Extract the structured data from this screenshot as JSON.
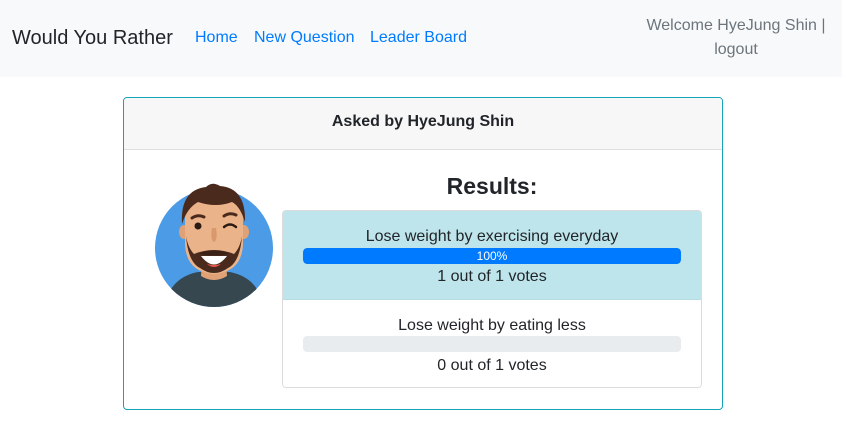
{
  "navbar": {
    "brand": "Would You Rather",
    "links": [
      "Home",
      "New Question",
      "Leader Board"
    ],
    "welcome": "Welcome HyeJung Shin |",
    "logout": "logout"
  },
  "poll": {
    "asked_by": "Asked by HyeJung Shin",
    "results_title": "Results:",
    "options": [
      {
        "text": "Lose weight by exercising everyday",
        "percent": 100,
        "percent_label": "100%",
        "votes": "1 out of 1 votes",
        "highlighted": true
      },
      {
        "text": "Lose weight by eating less",
        "percent": 0,
        "percent_label": "",
        "votes": "0 out of 1 votes",
        "highlighted": false
      }
    ]
  },
  "colors": {
    "link": "#007bff",
    "card_border": "#17a2b8",
    "winner_bg": "#bee5eb",
    "progress_fill": "#007bff",
    "progress_track": "#e9ecef"
  },
  "avatar": {
    "icon": "bearded-man-winking-avatar-icon"
  }
}
